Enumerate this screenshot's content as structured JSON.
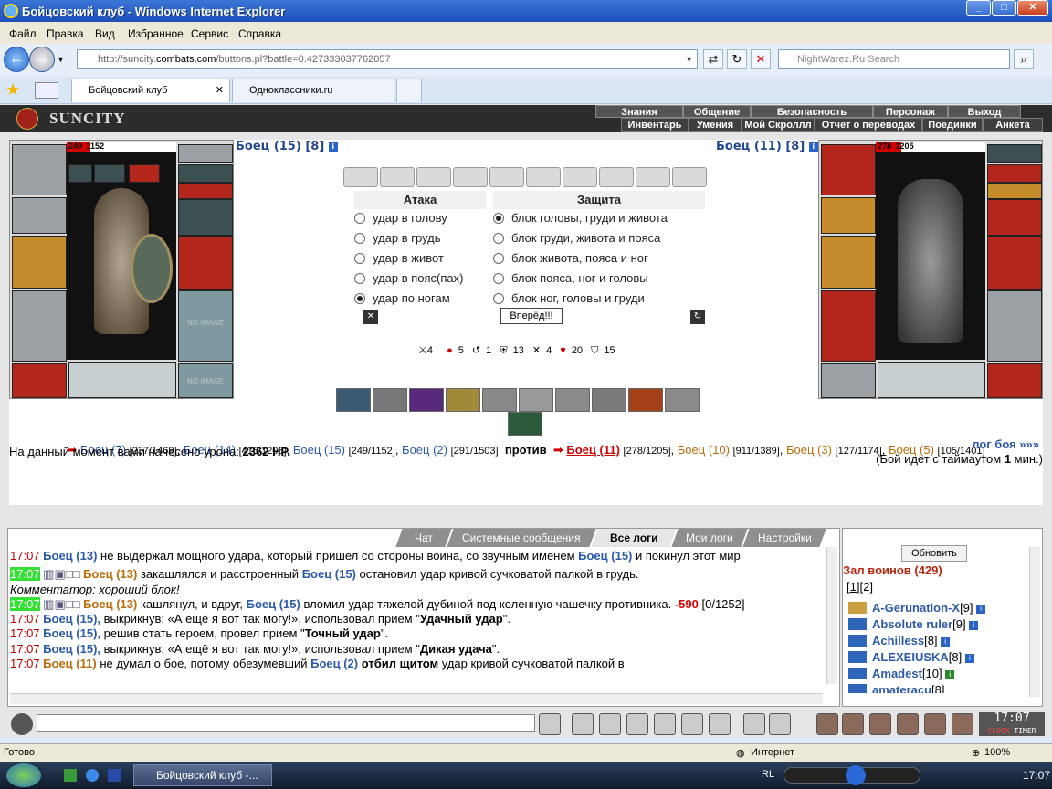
{
  "window": {
    "title": "Бойцовский клуб - Windows Internet Explorer"
  },
  "menu": [
    "Файл",
    "Правка",
    "Вид",
    "Избранное",
    "Сервис",
    "Справка"
  ],
  "address": {
    "prefix": "http://suncity.",
    "domain": "combats.com",
    "suffix": "/buttons.pl?battle=0.427333037762057"
  },
  "search": {
    "placeholder": "NightWarez.Ru Search"
  },
  "tabs": [
    {
      "label": "Бойцовский клуб"
    },
    {
      "label": "Одноклассники.ru"
    }
  ],
  "game": {
    "logo": "SUNCITY",
    "menu_top": [
      "Знания",
      "Общение",
      "Безопасность",
      "Персонаж",
      "Выход"
    ],
    "menu_bottom": [
      "Инвентарь",
      "Умения",
      "Мой Скроллл",
      "Отчет о переводах",
      "Поединки",
      "Анкета"
    ]
  },
  "player_left": {
    "name": "Боец (15)",
    "level": "[8]",
    "hp": "249",
    "hp_max": "1152",
    "hp_fraction": 0.216
  },
  "player_right": {
    "name": "Боец (11)",
    "level": "[8]",
    "hp": "278",
    "hp_max": "1205",
    "hp_fraction": 0.231
  },
  "no_image": "NO IMAGE",
  "attack": {
    "header": "Атака",
    "options": [
      "удар в голову",
      "удар в грудь",
      "удар в живот",
      "удар в пояс(пах)",
      "удар по ногам"
    ],
    "selected": 4
  },
  "defense": {
    "header": "Защита",
    "options": [
      "блок головы, груди и живота",
      "блок груди, живота и пояса",
      "блок живота, пояса и ног",
      "блок пояса, ног и головы",
      "блок ног, головы и груди"
    ],
    "selected": 0
  },
  "go_button": "Вперёд!!!",
  "stats": [
    "4",
    "5",
    "1",
    "13",
    "4",
    "20",
    "15"
  ],
  "versus": {
    "t1": [
      {
        "n": "Боец (7)",
        "s": "[237/1469]"
      },
      {
        "n": "Боец (14)",
        "s": "[416/1208]"
      },
      {
        "n": "Боец (15)",
        "s": "[249/1152]"
      },
      {
        "n": "Боец (2)",
        "s": "[291/1503]"
      }
    ],
    "vs": "против",
    "t2": [
      {
        "n": "Боец (11)",
        "s": "[278/1205]"
      },
      {
        "n": "Боец (10)",
        "s": "[911/1389]"
      },
      {
        "n": "Боец (3)",
        "s": "[127/1174]"
      },
      {
        "n": "Боец (5)",
        "s": "[105/1401]"
      }
    ]
  },
  "damage": {
    "label": "На данный момент вами нанесено урона:",
    "value": "2362 HP."
  },
  "loglink": "лог боя »»»",
  "timer": {
    "a": "(Бой идет с таймаутом ",
    "b": "1",
    "c": " мин.)"
  },
  "chat_tabs": [
    "Чат",
    "Системные сообщения",
    "Все логи",
    "Мои логи",
    "Настройки"
  ],
  "chat": {
    "time": "17:07",
    "l1a": "Боец (13)",
    "l1b": " не выдержал мощного удара, который пришел со стороны воина, со звучным именем ",
    "l1c": "Боец (15)",
    "l1d": " и покинул этот мир",
    "l2a": "Боец (13)",
    "l2b": " закашлялся и расстроенный ",
    "l2c": "Боец (15)",
    "l2d": " остановил удар кривой сучковатой палкой в грудь.",
    "l3": "Комментатор: хороший блок!",
    "l4a": "Боец (13)",
    "l4b": " кашлянул, и вдруг, ",
    "l4c": "Боец (15)",
    "l4d": " вломил удар тяжелой дубиной под коленную чашечку противника. ",
    "l4e": "-590",
    "l4f": " [0/1252]",
    "l5a": "Боец (15),",
    "l5b": " выкрикнув: «А ещё я вот так могу!», использовал прием \"",
    "l5c": "Удачный удар",
    "l5d": "\".",
    "l6a": "Боец (15),",
    "l6b": " решив стать героем, провел прием \"",
    "l6c": "Точный удар",
    "l6d": "\".",
    "l7a": "Боец (15),",
    "l7b": " выкрикнув: «А ещё я вот так могу!», использовал прием \"",
    "l7c": "Дикая удача",
    "l7d": "\".",
    "l8a": "Боец (11)",
    "l8b": " не думал о бое, потому обезумевший ",
    "l8c": "Боец (2)",
    "l8d": " отбил щитом",
    "l8e": " удар кривой сучковатой палкой в"
  },
  "room": {
    "refresh": "Обновить",
    "title": "Зал воинов (429)",
    "p1": "1",
    "p2": "2",
    "users": [
      {
        "n": "A-Gerunation-X",
        "l": "[9]"
      },
      {
        "n": "Absolute ruler",
        "l": "[9]"
      },
      {
        "n": "Achilless",
        "l": "[8]"
      },
      {
        "n": "ALEXEIUSKA",
        "l": "[8]"
      },
      {
        "n": "Amadest",
        "l": "[10]"
      },
      {
        "n": "amateracu",
        "l": "[8]"
      }
    ]
  },
  "clock": {
    "time": "17:07",
    "label1": "CLOCK",
    "label2": "TIMER"
  },
  "status": {
    "left": "Готово",
    "zone": "Интернет",
    "zoom": "100%"
  },
  "taskbar": {
    "item": "Бойцовский клуб -...",
    "lang": "RL",
    "time": "17:07"
  }
}
